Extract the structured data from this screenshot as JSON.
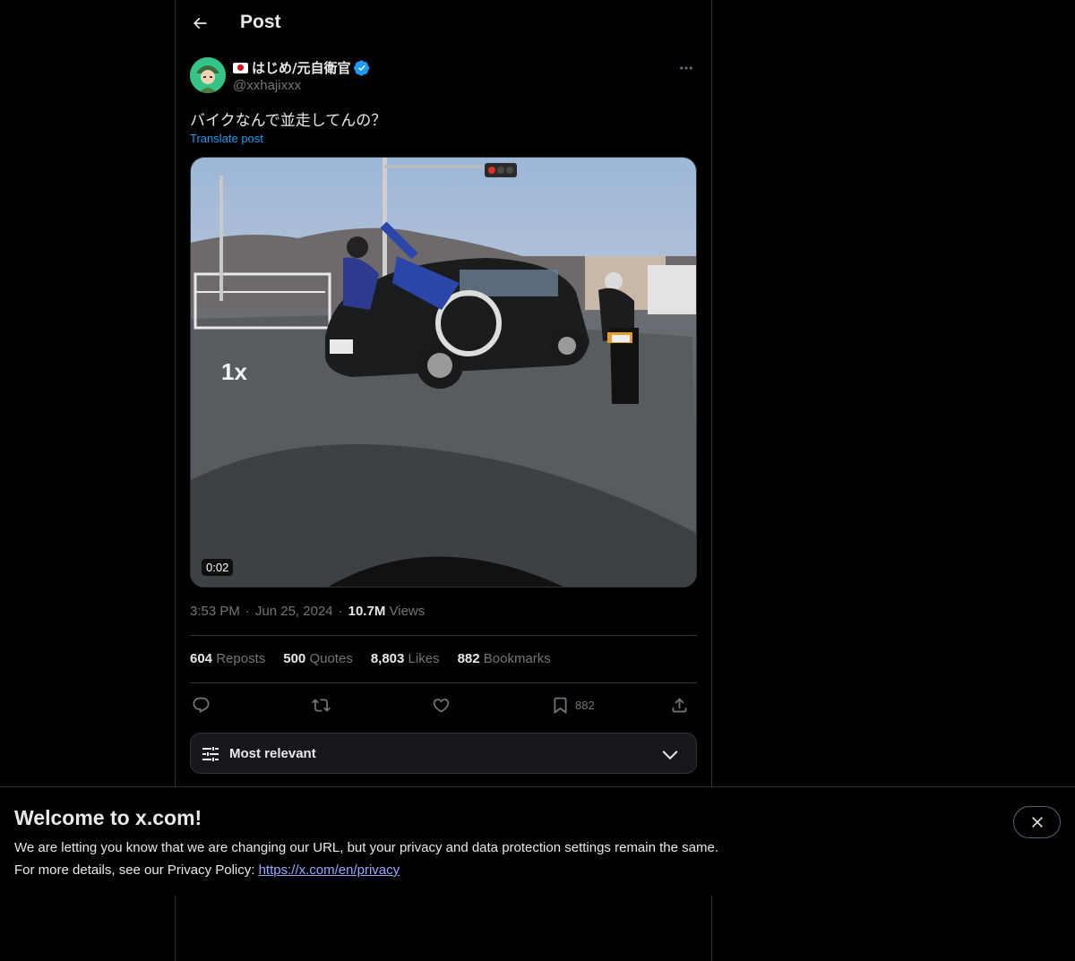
{
  "header": {
    "title": "Post"
  },
  "author": {
    "display_name": "はじめ/元自衛官",
    "handle": "@xxhajixxx"
  },
  "post": {
    "text": "バイクなんで並走してんの？",
    "translate_label": "Translate post",
    "media": {
      "duration": "0:02",
      "overlay_text": "1x"
    },
    "time": "3:53 PM",
    "date": "Jun 25, 2024",
    "views_count": "10.7M",
    "views_label": "Views"
  },
  "stats": [
    {
      "count": "604",
      "label": "Reposts"
    },
    {
      "count": "500",
      "label": "Quotes"
    },
    {
      "count": "8,803",
      "label": "Likes"
    },
    {
      "count": "882",
      "label": "Bookmarks"
    }
  ],
  "actions": {
    "bookmark_count": "882"
  },
  "sort": {
    "label": "Most relevant"
  },
  "banner": {
    "title": "Welcome to x.com!",
    "line1": "We are letting you know that we are changing our URL, but your privacy and data protection settings remain the same.",
    "line2_prefix": "For more details, see our Privacy Policy: ",
    "link": "https://x.com/en/privacy"
  },
  "colors": {
    "accent": "#1d9bf0",
    "background": "#000000",
    "muted": "#71767b",
    "border": "#2f3336"
  }
}
